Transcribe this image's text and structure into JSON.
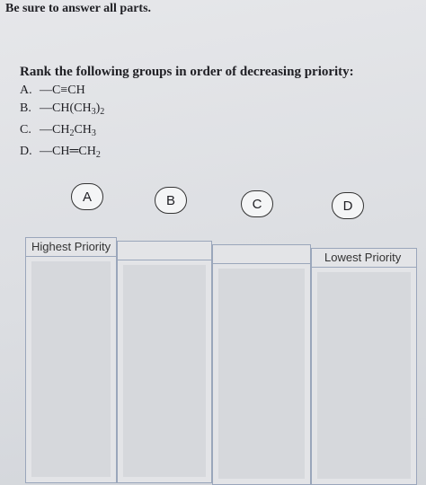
{
  "instructions": "Be sure to answer all parts.",
  "question": {
    "title": "Rank the following groups in order of decreasing priority:",
    "options": [
      {
        "label": "A.",
        "parts": [
          "—C",
          "≡",
          "CH"
        ]
      },
      {
        "label": "B.",
        "text": "—CH(CH",
        "sub1": "3",
        "close": ")",
        "sub2": "2"
      },
      {
        "label": "C.",
        "text": "—CH",
        "sub1": "2",
        "mid": "CH",
        "sub2": "3"
      },
      {
        "label": "D.",
        "text": "—CH",
        "eq": "═",
        "tail": "CH",
        "sub": "2"
      }
    ]
  },
  "tiles": [
    "A",
    "B",
    "C",
    "D"
  ],
  "slots": {
    "first_label": "Highest Priority",
    "last_label": "Lowest Priority"
  }
}
